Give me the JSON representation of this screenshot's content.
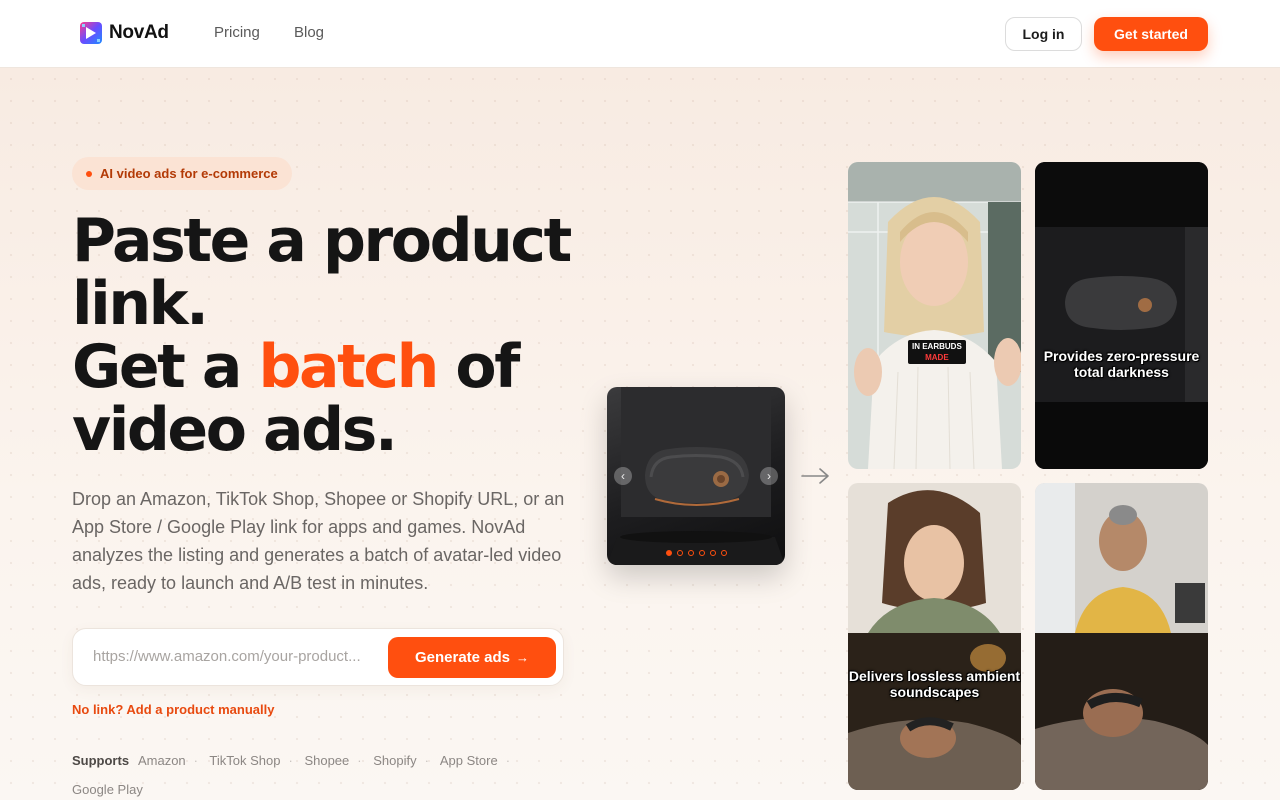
{
  "nav": {
    "brand": "NovAd",
    "links": [
      "Pricing",
      "Blog"
    ],
    "login_label": "Log in",
    "start_label": "Get started"
  },
  "hero": {
    "pill": "AI video ads for e-commerce",
    "headline": {
      "line1": "Paste a product link.",
      "line2_pre": "Get a ",
      "line2_accent": "batch",
      "line2_post": " of video ads."
    },
    "subtext": "Drop an Amazon, TikTok Shop, Shopee or Shopify URL, or an App Store / Google Play link for apps and games. NovAd analyzes the listing and generates a batch of avatar-led video ads, ready to launch and A/B test in minutes.",
    "url_placeholder": "https://www.amazon.com/your-product...",
    "generate_label": "Generate ads",
    "generate_arrow": "→",
    "manual_link": "No link? Add a product manually",
    "supports_label": "Supports",
    "platforms": [
      "Amazon",
      "TikTok Shop",
      "Shopee",
      "Shopify",
      "App Store",
      "Google Play"
    ]
  },
  "product_card": {
    "prev_icon": "‹",
    "next_icon": "›",
    "slide_count": 6,
    "active_slide": 1
  },
  "videos": [
    {
      "sticker_top": "IN EARBUDS",
      "sticker_bottom": "MADE",
      "caption": ""
    },
    {
      "caption": "Provides zero-pressure total darkness"
    },
    {
      "caption": "Delivers lossless ambient soundscapes"
    },
    {
      "caption": ""
    }
  ],
  "colors": {
    "accent": "#ff4f0f",
    "accent_dark": "#b33a06",
    "pill_bg": "#fbe3d4",
    "hero_bg": "#f8ebe2"
  }
}
